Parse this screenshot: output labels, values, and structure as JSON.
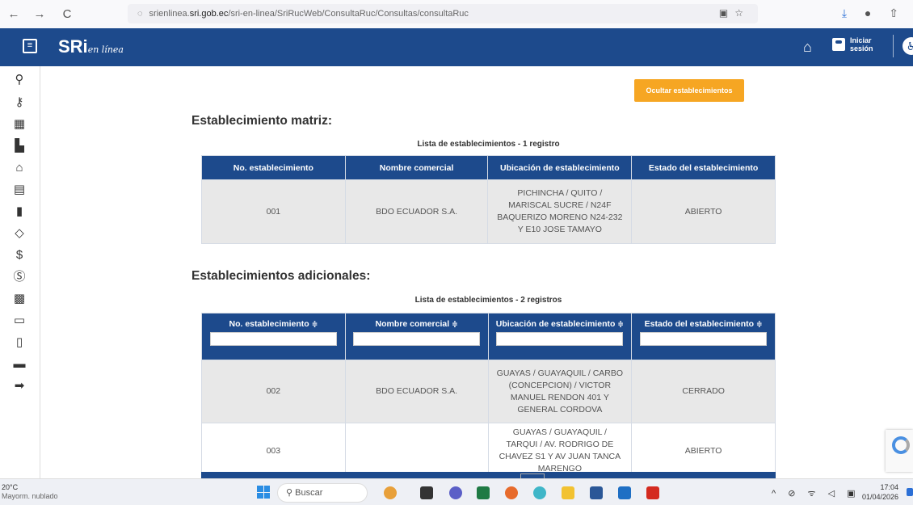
{
  "browser": {
    "back": "←",
    "forward": "→",
    "reload": "C",
    "url_prefix": "srienlinea.",
    "url_domain": "sri.gob.ec",
    "url_path": "/sri-en-linea/SriRucWeb/ConsultaRuc/Consultas/consultaRuc"
  },
  "header": {
    "logo_main": "SRi",
    "logo_sub": "en línea",
    "login_label": "Iniciar sesión"
  },
  "actions": {
    "hide_label": "Ocultar establecimientos"
  },
  "matriz": {
    "title": "Establecimiento matriz:",
    "caption": "Lista de establecimientos - 1 registro",
    "headers": [
      "No. establecimiento",
      "Nombre comercial",
      "Ubicación de establecimiento",
      "Estado del establecimiento"
    ],
    "rows": [
      {
        "num": "001",
        "nombre": "BDO ECUADOR S.A.",
        "ubicacion": "PICHINCHA / QUITO / MARISCAL SUCRE / N24F BAQUERIZO MORENO N24-232 Y E10 JOSE TAMAYO",
        "estado": "ABIERTO"
      }
    ]
  },
  "adicionales": {
    "title": "Establecimientos adicionales:",
    "caption": "Lista de establecimientos - 2 registros",
    "headers": [
      "No. establecimiento",
      "Nombre comercial",
      "Ubicación de establecimiento",
      "Estado del establecimiento"
    ],
    "sort_glyph": "≑",
    "rows": [
      {
        "num": "002",
        "nombre": "BDO ECUADOR S.A.",
        "ubicacion": "GUAYAS / GUAYAQUIL / CARBO (CONCEPCION) / VICTOR MANUEL RENDON 401 Y GENERAL CORDOVA",
        "estado": "CERRADO"
      },
      {
        "num": "003",
        "nombre": "",
        "ubicacion": "GUAYAS / GUAYAQUIL / TARQUI / AV. RODRIGO DE CHAVEZ S1 Y AV JUAN TANCA MARENGO",
        "estado": "ABIERTO"
      }
    ]
  },
  "taskbar": {
    "temp": "20°C",
    "weather": "Mayorm. nublado",
    "search": "Buscar",
    "time": "17:04",
    "date": "01/04/2026"
  },
  "colors": {
    "brand_blue": "#1d4a8c",
    "accent_orange": "#f6a623"
  }
}
